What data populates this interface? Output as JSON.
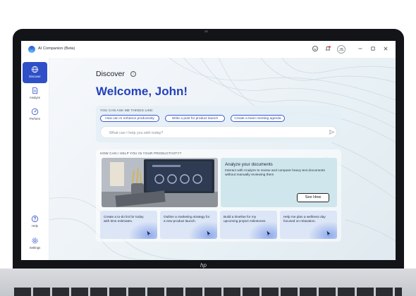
{
  "window": {
    "app_title": "AI Companion (Beta)",
    "avatar_initials": "JS"
  },
  "sidebar": {
    "items": [
      {
        "label": "Discover",
        "icon": "globe-icon",
        "active": true
      },
      {
        "label": "Analyze",
        "icon": "document-icon",
        "active": false
      },
      {
        "label": "Perform",
        "icon": "gauge-icon",
        "active": false
      }
    ],
    "bottom": [
      {
        "label": "Help",
        "icon": "help-icon"
      },
      {
        "label": "Settings",
        "icon": "gear-icon"
      }
    ]
  },
  "main": {
    "page_title": "Discover",
    "welcome": "Welcome, John!",
    "ask": {
      "label": "YOU CAN ASK ME THINGS LIKE:",
      "chips": [
        "How can AI enhance productivity",
        "Write a post for product launch",
        "Create a team meeting agenda"
      ],
      "placeholder": "What can I help you with today?"
    },
    "productivity": {
      "label": "HOW CAN I HELP YOU IN YOUR PRODUCTIVITY?",
      "analyze_title": "Analyze your documents",
      "analyze_desc": "Interact with Analyze to review and compare heavy text documents without manually reviewing them",
      "see_how": "See How",
      "tasks": [
        "Create a to-do list for today with time estimates.",
        "Outline a marketing strategy for a new product launch.",
        "Build a timeline for my upcoming project milestones.",
        "Help me plan a wellness day focused on relaxation."
      ]
    }
  },
  "colors": {
    "accent": "#2f4fc8",
    "welcome": "#2441b8",
    "analyze_card": "#cfe6ec",
    "task_card": "#dde6f6"
  }
}
